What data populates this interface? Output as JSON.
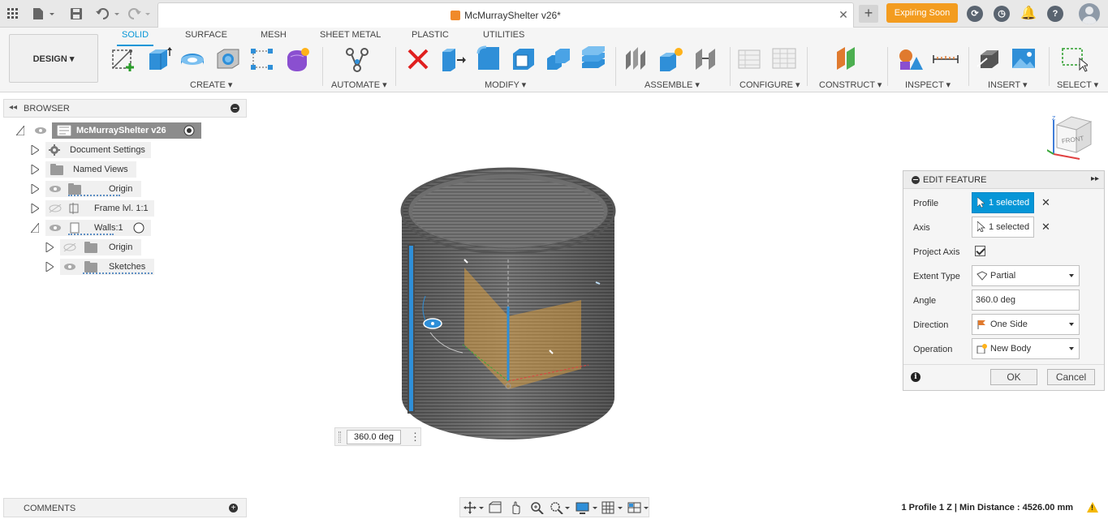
{
  "window": {
    "document_title": "McMurrayShelter v26*",
    "expiring_label": "Expiring Soon"
  },
  "ribbon": {
    "workspace_label": "DESIGN",
    "tabs": [
      "SOLID",
      "SURFACE",
      "MESH",
      "SHEET METAL",
      "PLASTIC",
      "UTILITIES"
    ],
    "active_tab": "SOLID",
    "groups": [
      "CREATE",
      "AUTOMATE",
      "MODIFY",
      "ASSEMBLE",
      "CONFIGURE",
      "CONSTRUCT",
      "INSPECT",
      "INSERT",
      "SELECT"
    ]
  },
  "browser": {
    "title": "BROWSER",
    "root": "McMurrayShelter v26",
    "items": [
      {
        "label": "Document Settings",
        "icon": "gear-icon"
      },
      {
        "label": "Named Views",
        "icon": "folder-icon"
      },
      {
        "label": "Origin",
        "icon": "folder-icon"
      },
      {
        "label": "Frame lvl. 1:1",
        "icon": "component-icon"
      },
      {
        "label": "Walls:1",
        "icon": "component-icon"
      },
      {
        "label": "Origin",
        "icon": "folder-icon"
      },
      {
        "label": "Sketches",
        "icon": "folder-icon"
      }
    ]
  },
  "edit_feature": {
    "title": "EDIT FEATURE",
    "profile_label": "Profile",
    "profile_value": "1 selected",
    "axis_label": "Axis",
    "axis_value": "1 selected",
    "project_axis_label": "Project Axis",
    "project_axis_checked": true,
    "extent_type_label": "Extent Type",
    "extent_type_value": "Partial",
    "angle_label": "Angle",
    "angle_value": "360.0 deg",
    "direction_label": "Direction",
    "direction_value": "One Side",
    "operation_label": "Operation",
    "operation_value": "New Body",
    "ok_label": "OK",
    "cancel_label": "Cancel"
  },
  "viewport": {
    "angle_input_value": "360.0 deg",
    "viewcube_face": "FRONT"
  },
  "comments_label": "COMMENTS",
  "status_bar": "1 Profile 1 Z | Min Distance : 4526.00 mm",
  "colors": {
    "accent": "#0696d7",
    "expiring": "#f39c1f",
    "profile_fill": "#f0a83a"
  }
}
